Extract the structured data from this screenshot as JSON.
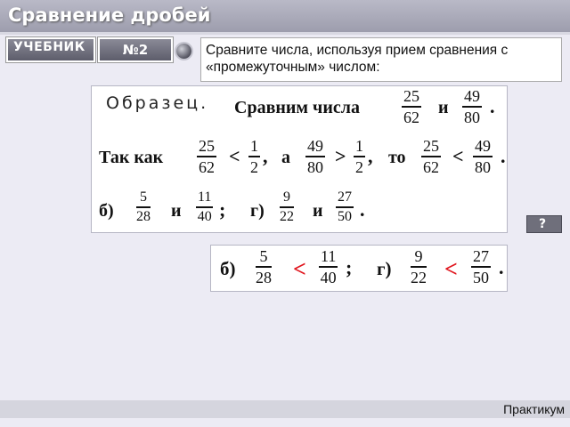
{
  "title": "Сравнение дробей",
  "tag_book": "УЧЕБНИК",
  "tag_number": "№2",
  "task_text": "Сравните числа, используя прием сравнения с «промежуточным» числом:",
  "sample": {
    "heading": "Образец.",
    "line1_text": "Сравним числа",
    "and": "и",
    "f1": {
      "n": "25",
      "d": "62"
    },
    "f2": {
      "n": "49",
      "d": "80"
    },
    "dot": ".",
    "line2_lead": "Так как",
    "lt": "<",
    "gt": ">",
    "comma": ",",
    "a": "а",
    "half": {
      "n": "1",
      "d": "2"
    },
    "then": "то",
    "b_label": "б)",
    "g_label": "г)",
    "b1": {
      "n": "5",
      "d": "28"
    },
    "b2": {
      "n": "11",
      "d": "40"
    },
    "g1": {
      "n": "9",
      "d": "22"
    },
    "g2": {
      "n": "27",
      "d": "50"
    },
    "semicolon": ";"
  },
  "answer": {
    "b_label": "б)",
    "g_label": "г)",
    "b1": {
      "n": "5",
      "d": "28"
    },
    "b2": {
      "n": "11",
      "d": "40"
    },
    "g1": {
      "n": "9",
      "d": "22"
    },
    "g2": {
      "n": "27",
      "d": "50"
    },
    "b_sign": "<",
    "g_sign": "<",
    "semicolon": ";",
    "dot": "."
  },
  "hint_label": "?",
  "footer": "Практикум",
  "colors": {
    "accent_red": "#e0141c",
    "bar_gray": "#9d9dad"
  },
  "icons": {
    "bullet": "round-bullet-icon"
  }
}
